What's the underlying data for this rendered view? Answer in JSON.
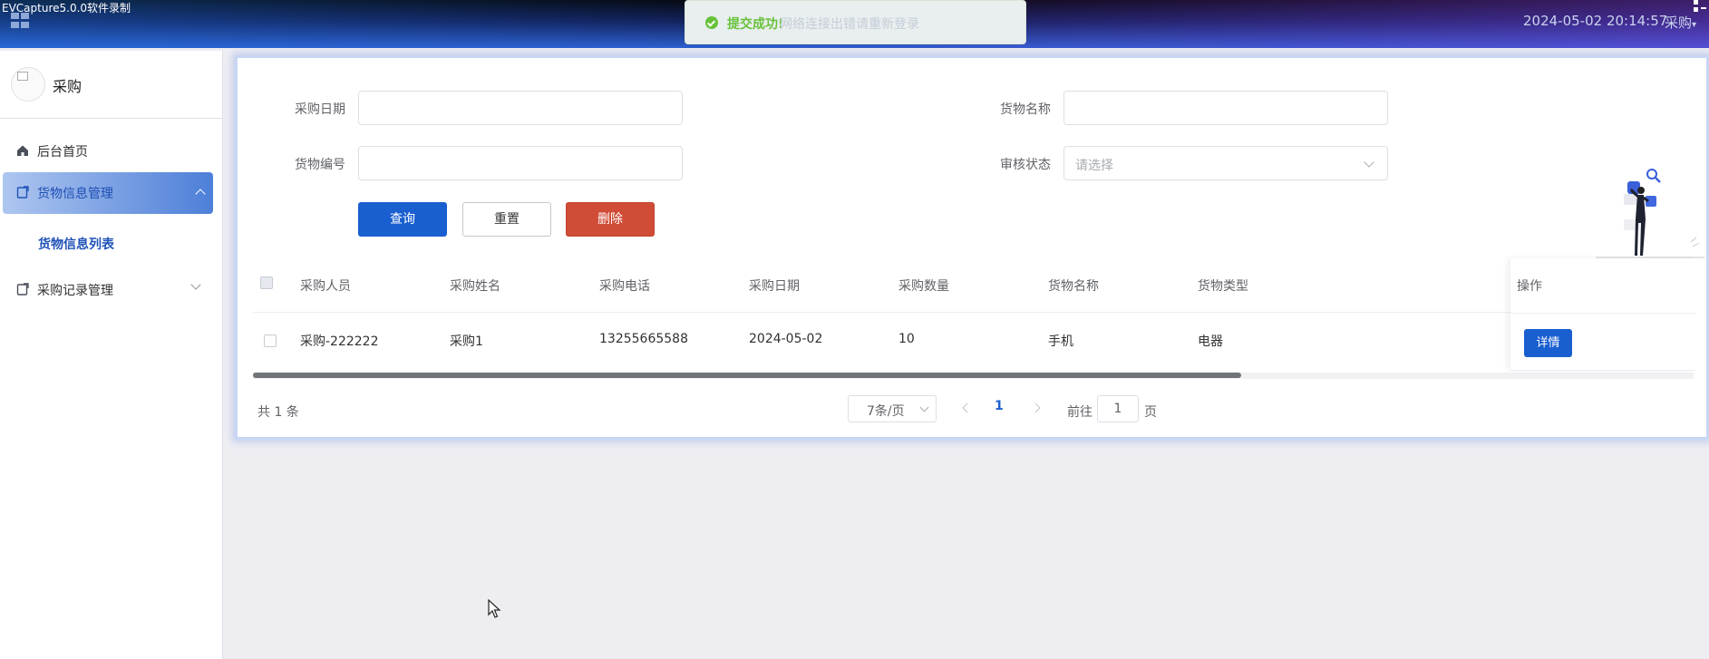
{
  "recorder": {
    "label": "EVCapture5.0.0软件录制"
  },
  "header": {
    "datetime": "2024-05-02 20:14:57",
    "user": "采购"
  },
  "toast": {
    "message": "提交成功!",
    "faded_text": "网络连接出错请重新登录"
  },
  "sidebar": {
    "brand": "采购",
    "items": [
      {
        "label": "后台首页",
        "icon": "home-icon"
      },
      {
        "label": "货物信息管理",
        "icon": "document-icon",
        "expanded": true
      },
      {
        "label": "采购记录管理",
        "icon": "document-icon",
        "expanded": false
      }
    ],
    "sub_items": [
      {
        "label": "货物信息列表"
      }
    ]
  },
  "search": {
    "purchase_date_label": "采购日期",
    "goods_name_label": "货物名称",
    "goods_no_label": "货物编号",
    "audit_status_label": "审核状态",
    "audit_status_placeholder": "请选择",
    "query_label": "查询",
    "reset_label": "重置",
    "delete_label": "删除"
  },
  "table": {
    "columns": [
      "采购人员",
      "采购姓名",
      "采购电话",
      "采购日期",
      "采购数量",
      "货物名称",
      "货物类型",
      "操作"
    ],
    "rows": [
      {
        "cells": [
          "采购-222222",
          "采购1",
          "13255665588",
          "2024-05-02",
          "10",
          "手机",
          "电器"
        ],
        "action": "详情"
      }
    ]
  },
  "pagination": {
    "total": "共 1 条",
    "page_size": "7条/页",
    "current_page": "1",
    "goto_prefix": "前往",
    "goto_value": "1",
    "goto_suffix": "页"
  },
  "colors": {
    "primary": "#1a5fd0",
    "danger": "#d04c36",
    "success": "#67c23a"
  }
}
